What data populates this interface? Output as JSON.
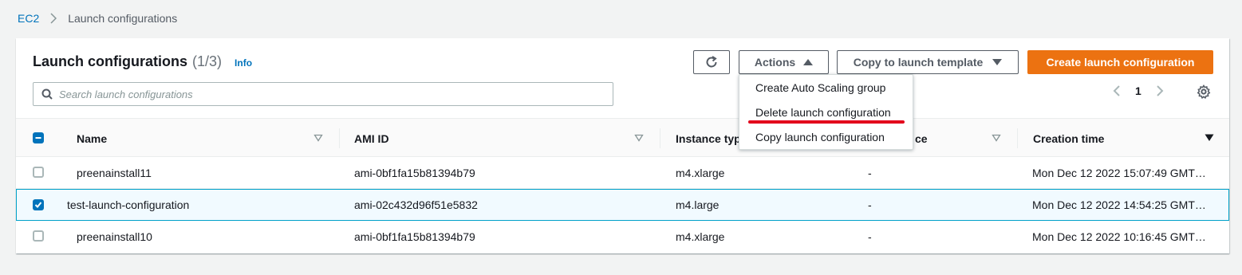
{
  "breadcrumb": {
    "root": "EC2",
    "current": "Launch configurations"
  },
  "panel": {
    "title": "Launch configurations",
    "count": "(1/3)",
    "info": "Info"
  },
  "buttons": {
    "refresh_icon": "refresh-icon",
    "actions": "Actions",
    "copy": "Copy to launch template",
    "create": "Create launch configuration"
  },
  "search": {
    "placeholder": "Search launch configurations",
    "value": ""
  },
  "pagination": {
    "page": "1"
  },
  "columns": [
    {
      "label": "Name"
    },
    {
      "label": "AMI ID"
    },
    {
      "label": "Instance typ"
    },
    {
      "label": "ce"
    },
    {
      "label": "Creation time"
    }
  ],
  "rows": [
    {
      "name": "preenainstall11",
      "ami": "ami-0bf1fa15b81394b79",
      "instance_type": "m4.xlarge",
      "other": "-",
      "created": "Mon Dec 12 2022 15:07:49 GMT…",
      "selected": false
    },
    {
      "name": "test-launch-configuration",
      "ami": "ami-02c432d96f51e5832",
      "instance_type": "m4.large",
      "other": "-",
      "created": "Mon Dec 12 2022 14:54:25 GMT…",
      "selected": true
    },
    {
      "name": "preenainstall10",
      "ami": "ami-0bf1fa15b81394b79",
      "instance_type": "m4.xlarge",
      "other": "-",
      "created": "Mon Dec 12 2022 10:16:45 GMT…",
      "selected": false
    }
  ],
  "actions_menu": [
    {
      "label": "Create Auto Scaling group"
    },
    {
      "label": "Delete launch configuration"
    },
    {
      "label": "Copy launch configuration"
    }
  ],
  "colors": {
    "accent": "#0073bb",
    "primary_button": "#ec7211",
    "highlight_underline": "#e3001b"
  }
}
